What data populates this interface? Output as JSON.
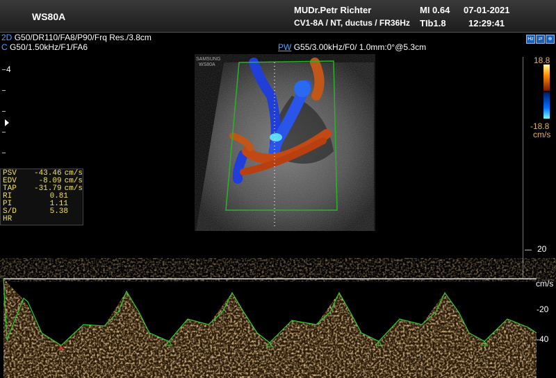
{
  "header": {
    "model": "WS80A",
    "doctor": "MUDr.Petr Richter",
    "probe_line": "CV1-8A / NT, ductus / FR36Hz",
    "mi": "MI  0.64",
    "tib": "TIb1.8",
    "date": "07-01-2021",
    "time": "12:29:41"
  },
  "params": {
    "twod_label": "2D",
    "twod_value": "G50/DR110/FA8/P90/Frq Res./3.8cm",
    "c_label": "C",
    "c_value": "G50/1.50kHz/F1/FA6",
    "pw_label": "PW",
    "pw_value": "G55/3.00kHz/F0/ 1.0mm:0°@5.3cm"
  },
  "depth_marker": "4",
  "watermark": [
    "SAMSUNG",
    "WS80A"
  ],
  "color_scale": {
    "top": "18.8",
    "bottom": "-18.8",
    "unit": "cm/s"
  },
  "measurements": [
    {
      "label": "PSV",
      "value": "-43.46",
      "unit": "cm/s"
    },
    {
      "label": "EDV",
      "value": "-8.09",
      "unit": "cm/s"
    },
    {
      "label": "TAP",
      "value": "-31.79",
      "unit": "cm/s"
    },
    {
      "label": "RI",
      "value": "0.81",
      "unit": ""
    },
    {
      "label": "PI",
      "value": "1.11",
      "unit": ""
    },
    {
      "label": "S/D",
      "value": "5.38",
      "unit": ""
    },
    {
      "label": "HR",
      "value": "",
      "unit": ""
    }
  ],
  "doppler_scale": {
    "unit": "cm/s",
    "labels": [
      "20",
      "-20",
      "-40"
    ]
  },
  "icons": {
    "top_right": [
      "hr-icon",
      "flip-icon",
      "zoom-icon"
    ]
  },
  "colors": {
    "param_blue": "#4fa3ff",
    "measure_yellow": "#f2e35a",
    "trace_green": "#2ecc2e",
    "spectrum_orange": "#b8823a"
  }
}
